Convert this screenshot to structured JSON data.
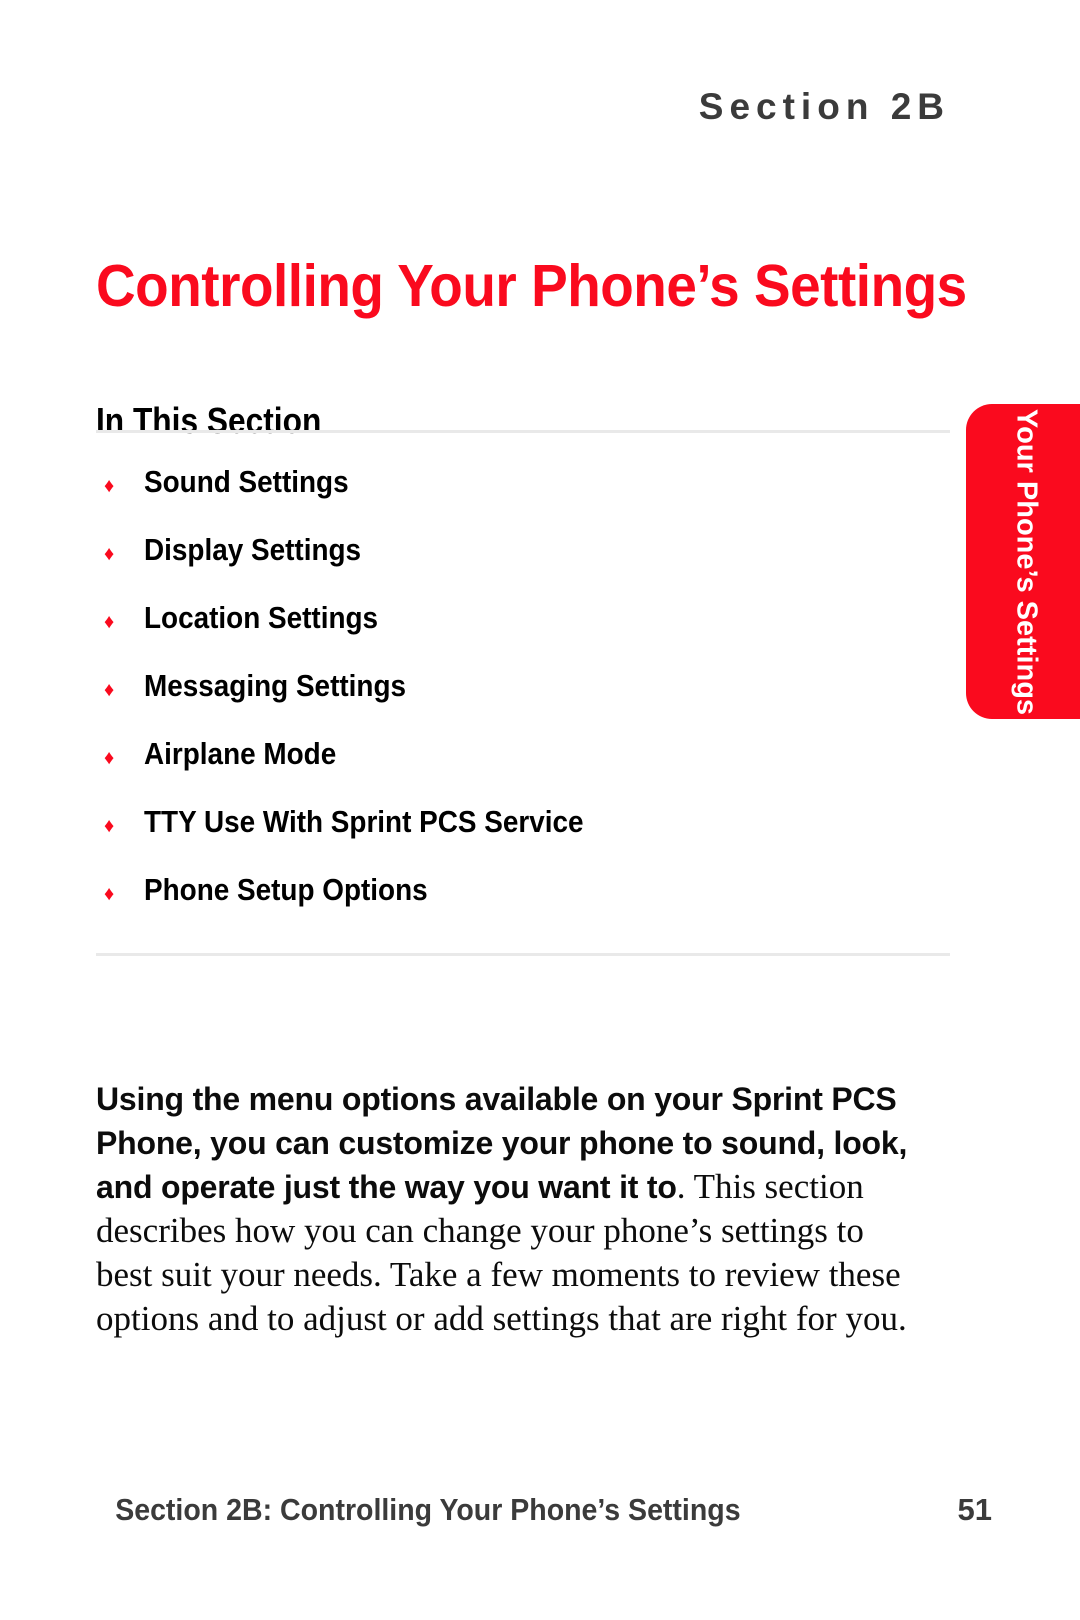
{
  "section_eyebrow": "Section 2B",
  "page_title": "Controlling Your Phone’s Settings",
  "in_this_section": {
    "heading": "In This Section",
    "bullet_glyph": "♦",
    "items": [
      {
        "label": "Sound Settings"
      },
      {
        "label": "Display Settings"
      },
      {
        "label": "Location Settings"
      },
      {
        "label": "Messaging Settings"
      },
      {
        "label": "Airplane Mode"
      },
      {
        "label": "TTY Use With Sprint PCS Service"
      },
      {
        "label": "Phone Setup Options"
      }
    ]
  },
  "side_tab": {
    "label": "Your Phone’s Settings",
    "color": "#fa0a1e",
    "text_color": "#ffffff"
  },
  "intro": {
    "lead": "Using the menu options available on your Sprint PCS Phone, you can customize your phone to sound, look, and operate just the way you want it to",
    "rest": ". This section describes how you can change your phone’s settings to best suit your needs. Take a few moments to review these options and to adjust or add settings that are right for you."
  },
  "footer": {
    "left": "Section 2B: Controlling Your Phone’s Settings",
    "page_number": "51"
  },
  "colors": {
    "accent_red": "#fa0a1e",
    "header_gray": "#3b3b3b",
    "rule_gray": "#e9e9e9",
    "body_black": "#0c0c0c"
  }
}
